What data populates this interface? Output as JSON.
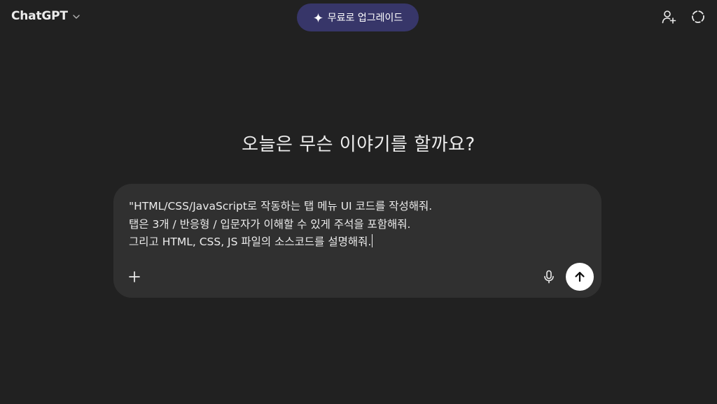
{
  "header": {
    "model_label": "ChatGPT",
    "upgrade_label": "무료로 업그레이드",
    "icons": {
      "model_dropdown": "chevron-down-icon",
      "upgrade": "sparkle-icon",
      "add_user": "add-user-icon",
      "temporary_chat": "temporary-chat-icon"
    }
  },
  "main": {
    "headline": "오늘은 무슨 이야기를 할까요?"
  },
  "composer": {
    "lines": [
      "\"HTML/CSS/JavaScript로 작동하는 탭 메뉴 UI 코드를 작성해줘.",
      "탭은 3개 / 반응형 / 입문자가 이해할 수 있게 주석을 포함해줘.",
      "그리고 HTML, CSS, JS 파일의 소스코드를 설명해줘."
    ],
    "icons": {
      "attach": "plus-icon",
      "voice": "microphone-icon",
      "send": "arrow-up-icon"
    }
  },
  "colors": {
    "background": "#212121",
    "composer_bg": "#303030",
    "upgrade_bg": "#373669",
    "text": "#ececec",
    "send_bg": "#ffffff"
  }
}
